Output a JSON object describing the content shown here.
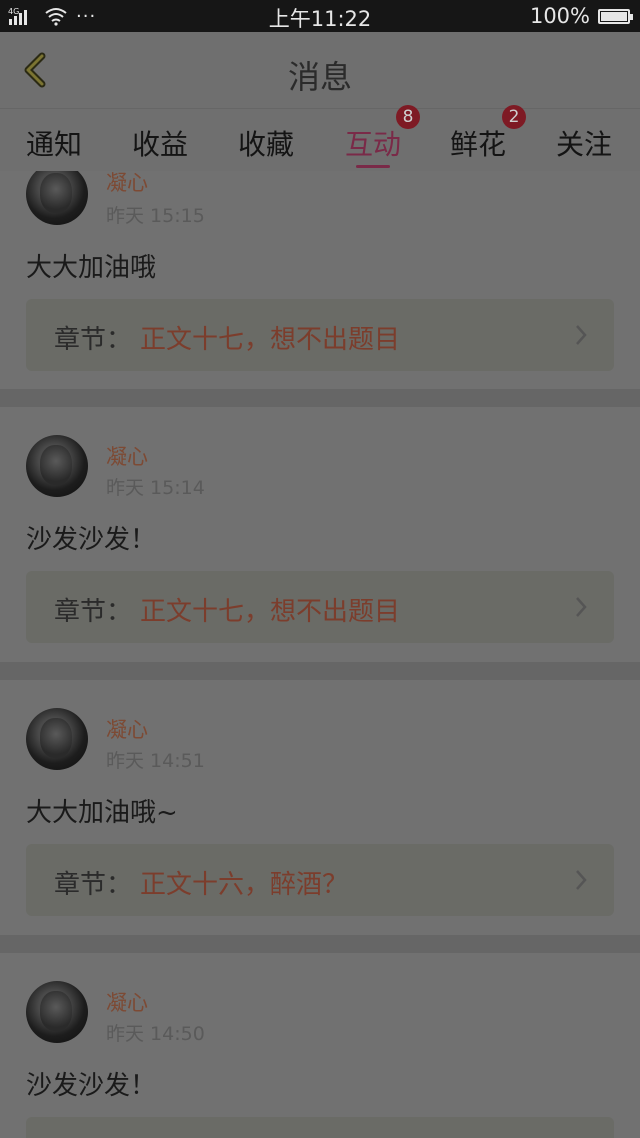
{
  "status_bar": {
    "network": "4G",
    "more": "···",
    "time": "上午11:22",
    "battery": "100%"
  },
  "header": {
    "title": "消息",
    "back_icon": "chevron-left-icon"
  },
  "tabs": [
    {
      "label": "通知",
      "badge": ""
    },
    {
      "label": "收益",
      "badge": ""
    },
    {
      "label": "收藏",
      "badge": ""
    },
    {
      "label": "互动",
      "badge": "8"
    },
    {
      "label": "鲜花",
      "badge": "2"
    },
    {
      "label": "关注",
      "badge": ""
    }
  ],
  "active_tab": "互动",
  "colors": {
    "accent": "#7a2a48",
    "badge": "#7e1a24",
    "username": "#7d4a34",
    "chapter_title": "#7c3d2c"
  },
  "messages": [
    {
      "user": "凝心",
      "time": "昨天 15:15",
      "comment": "大大加油哦",
      "chapter_label": "章节：",
      "chapter_title": "正文十七，想不出题目"
    },
    {
      "user": "凝心",
      "time": "昨天 15:14",
      "comment": "沙发沙发！",
      "chapter_label": "章节：",
      "chapter_title": "正文十七，想不出题目"
    },
    {
      "user": "凝心",
      "time": "昨天 14:51",
      "comment": "大大加油哦~",
      "chapter_label": "章节：",
      "chapter_title": "正文十六，醉酒？"
    },
    {
      "user": "凝心",
      "time": "昨天 14:50",
      "comment": "沙发沙发！",
      "chapter_label": "章节：",
      "chapter_title": ""
    }
  ]
}
